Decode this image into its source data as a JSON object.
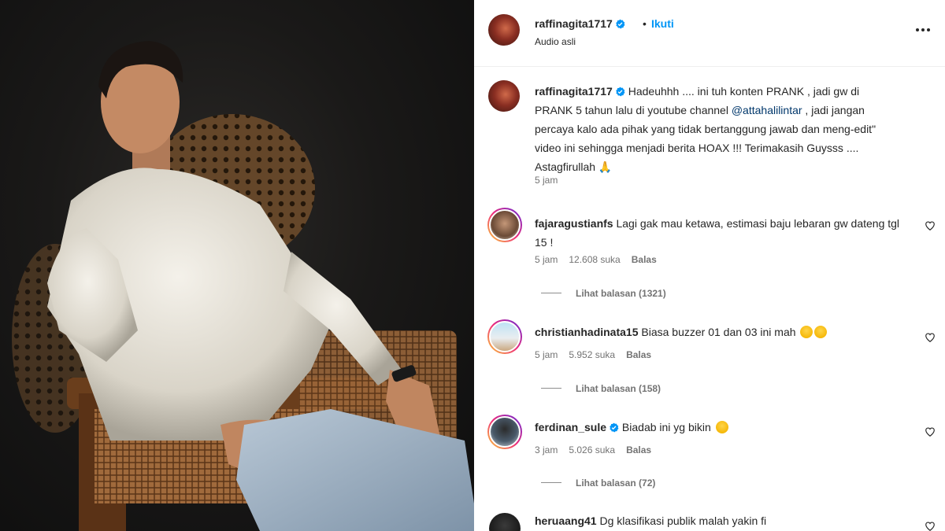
{
  "post": {
    "author": "raffinagita1717",
    "follow_label": "Ikuti",
    "separator": "•",
    "audio": "Audio asli",
    "caption": {
      "author": "raffinagita1717",
      "text_before": "Hadeuhhh .... ini tuh konten PRANK , jadi gw di PRANK 5 tahun lalu di youtube channel ",
      "mention": "@attahalilintar",
      "text_after": " , jadi jangan percaya kalo ada pihak yang tidak bertanggung jawab dan meng-edit\" video ini sehingga menjadi berita HOAX !!! Terimakasih Guysss .... Astagfirullah 🙏",
      "time": "5 jam"
    }
  },
  "comments": [
    {
      "user": "fajaragustianfs",
      "verified": false,
      "text": "Lagi gak mau ketawa, estimasi baju lebaran gw dateng tgl 15 !",
      "time": "5 jam",
      "likes": "12.608 suka",
      "reply_label": "Balas",
      "view_replies": "Lihat balasan (1321)"
    },
    {
      "user": "christianhadinata15",
      "verified": false,
      "text": "Biasa buzzer 01 dan 03 ini mah",
      "time": "5 jam",
      "likes": "5.952 suka",
      "reply_label": "Balas",
      "view_replies": "Lihat balasan (158)"
    },
    {
      "user": "ferdinan_sule",
      "verified": true,
      "text": "Biadab ini yg bikin",
      "time": "3 jam",
      "likes": "5.026 suka",
      "reply_label": "Balas",
      "view_replies": "Lihat balasan (72)"
    },
    {
      "user": "heruaang41",
      "verified": false,
      "text": "Dg klasifikasi publik malah yakin fi"
    }
  ],
  "icons": {
    "verified_color": "#0095f6",
    "link_color": "#0095f6",
    "mention_color": "#00376b"
  }
}
